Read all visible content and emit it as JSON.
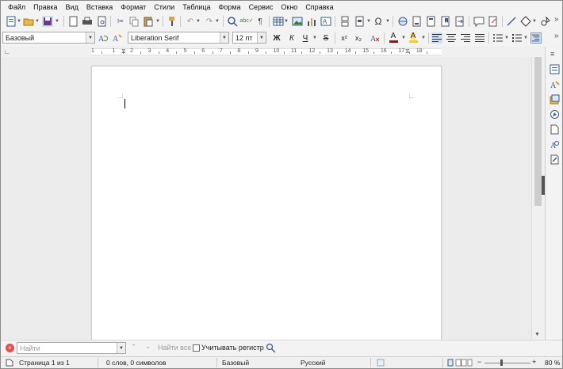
{
  "menu": [
    "Файл",
    "Правка",
    "Вид",
    "Вставка",
    "Формат",
    "Стили",
    "Таблица",
    "Форма",
    "Сервис",
    "Окно",
    "Справка"
  ],
  "formatting": {
    "paragraph_style": "Базовый",
    "font_name": "Liberation Serif",
    "font_size": "12 пт",
    "bold": "Ж",
    "italic": "К",
    "underline": "Ч",
    "strike": "S",
    "superscript": "x²",
    "subscript": "x₂",
    "font_color_glyph": "A",
    "highlight_glyph": "A",
    "font_color": "#c00000",
    "highlight_color": "#ffd000"
  },
  "ruler": {
    "labels": [
      "1",
      "1",
      "2",
      "3",
      "4",
      "5",
      "6",
      "7",
      "8",
      "9",
      "10",
      "11",
      "12",
      "13",
      "14",
      "15",
      "16",
      "17",
      "18"
    ]
  },
  "findbar": {
    "placeholder": "Найти",
    "find_all": "Найти все",
    "match_case": "Учитывать регистр"
  },
  "status": {
    "page": "Страница 1 из 1",
    "words": "0 слов, 0 символов",
    "style": "Базовый",
    "language": "Русский",
    "zoom": "80 %"
  },
  "colors": {
    "accent": "#3a5a8a",
    "selected_button": "#cfe0f5"
  }
}
